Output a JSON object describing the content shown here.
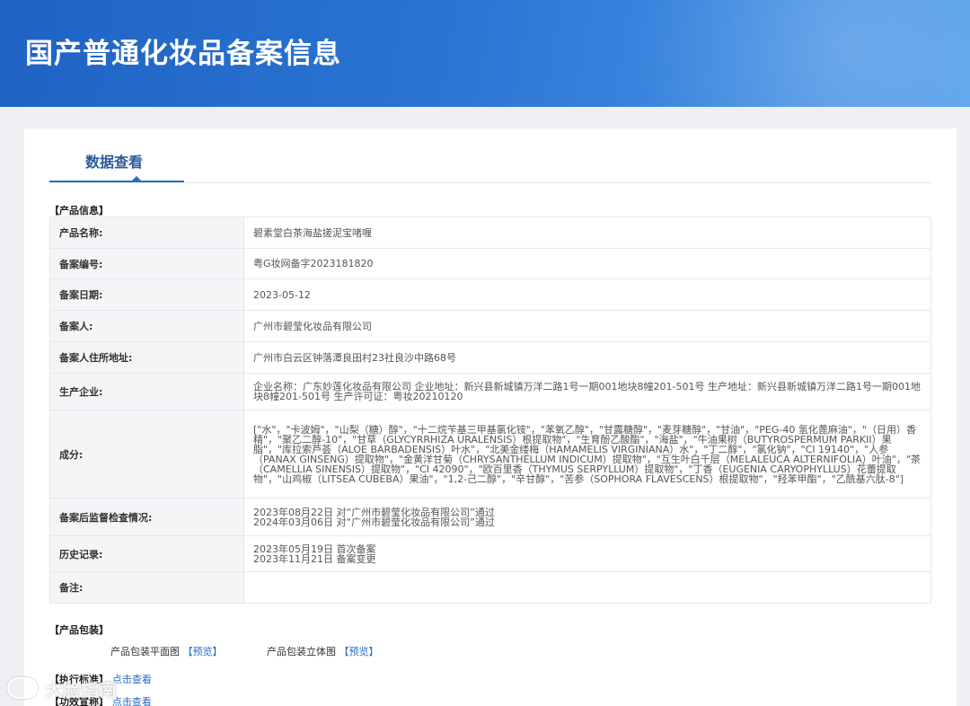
{
  "header": {
    "title": "国产普通化妆品备案信息"
  },
  "tab": {
    "label": "数据查看"
  },
  "product_section": {
    "label": "【产品信息】"
  },
  "product_rows": [
    {
      "key": "产品名称:",
      "value": "碧素堂白茶海盐搓泥宝啫喱"
    },
    {
      "key": "备案编号:",
      "value": "粤G妆网备字2023181820"
    },
    {
      "key": "备案日期:",
      "value": "2023-05-12"
    },
    {
      "key": "备案人:",
      "value": "广州市碧莹化妆品有限公司"
    },
    {
      "key": "备案人住所地址:",
      "value": "广州市白云区钟落潭良田村23社良沙中路68号"
    },
    {
      "key": "生产企业:",
      "value": "企业名称：广东妙莲化妆品有限公司 企业地址：新兴县新城镇万洋二路1号一期001地块8幢201-501号 生产地址：新兴县新城镇万洋二路1号一期001地块8幢201-501号 生产许可证：粤妆20210120"
    },
    {
      "key": "成分:",
      "value": "[\"水\"，\"卡波姆\"，\"山梨（糖）醇\"，\"十二烷苄基三甲基氯化铵\"，\"苯氧乙醇\"，\"甘露糖醇\"，\"麦芽糖醇\"，\"甘油\"，\"PEG-40 氢化蓖麻油\"，\"（日用）香精\"，\"聚乙二醇-10\"，\"甘草（GLYCYRRHIZA URALENSIS）根提取物\"，\"生育酚乙酸酯\"，\"海盐\"，\"牛油果树（BUTYROSPERMUM PARKII）果脂\"，\"库拉索芦荟（ALOE BARBADENSIS）叶水\"，\"北美金缕梅（HAMAMELIS VIRGINIANA）水\"，\"丁二醇\"，\"氯化钠\"，\"CI 19140\"，\"人参（PANAX GINSENG）提取物\"，\"金黄洋甘菊（CHRYSANTHELLUM INDICUM）提取物\"，\"互生叶白千层（MELALEUCA ALTERNIFOLIA）叶油\"，\"茶（CAMELLIA SINENSIS）提取物\"，\"CI 42090\"，\"欧百里香（THYMUS SERPYLLUM）提取物\"，\"丁香（EUGENIA CARYOPHYLLUS）花蕾提取物\"，\"山鸡椒（LITSEA CUBEBA）果油\"，\"1,2-己二醇\"，\"辛甘醇\"，\"苦参（SOPHORA FLAVESCENS）根提取物\"，\"羟苯甲酯\"，\"乙酰基六肽-8\"]"
    },
    {
      "key": "备案后监督检查情况:",
      "lines": [
        "2023年08月22日 对“广州市碧莹化妆品有限公司”通过",
        "2024年03月06日 对“广州市碧莹化妆品有限公司”通过"
      ]
    },
    {
      "key": "历史记录:",
      "lines": [
        "2023年05月19日 首次备案",
        "2023年11月21日 备案变更"
      ]
    },
    {
      "key": "备注:",
      "value": ""
    }
  ],
  "packaging": {
    "label": "【产品包装】",
    "flat_label": "产品包装平面图",
    "flat_link": "【预览】",
    "solid_label": "产品包装立体图",
    "solid_link": "【预览】"
  },
  "standard": {
    "label": "【执行标准】",
    "link": "点击查看"
  },
  "efficacy": {
    "label": "【功效宣称】",
    "link": "点击查看"
  },
  "watermark": {
    "text": "大脸指南"
  }
}
